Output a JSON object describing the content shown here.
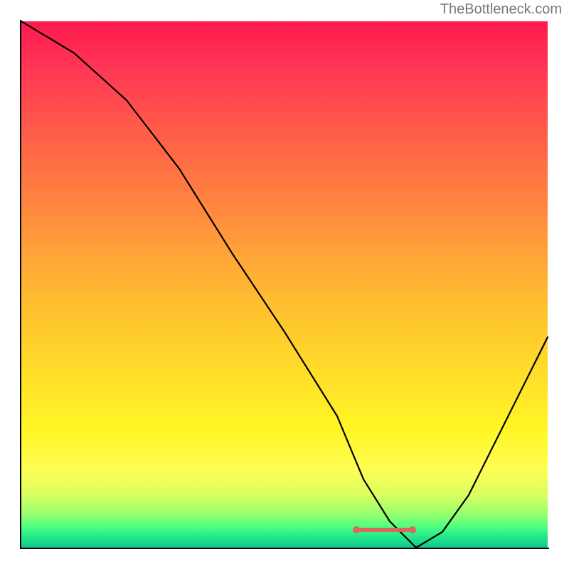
{
  "watermark": "TheBottleneck.com",
  "chart_data": {
    "type": "line",
    "title": "",
    "xlabel": "",
    "ylabel": "",
    "xlim": [
      0,
      100
    ],
    "ylim": [
      0,
      100
    ],
    "grid": false,
    "series": [
      {
        "name": "bottleneck-curve",
        "x": [
          0,
          10,
          20,
          30,
          40,
          50,
          60,
          65,
          70,
          75,
          80,
          85,
          100
        ],
        "values": [
          100,
          94,
          85,
          72,
          56,
          41,
          25,
          13,
          5,
          0,
          3,
          10,
          40
        ]
      }
    ],
    "background_gradient": {
      "top": "#ff1a4d",
      "mid": "#ffe029",
      "bottom": "#10c98a"
    },
    "optimal_range": {
      "x_start": 63,
      "x_end": 75
    },
    "marker_color": "#d9675f"
  }
}
